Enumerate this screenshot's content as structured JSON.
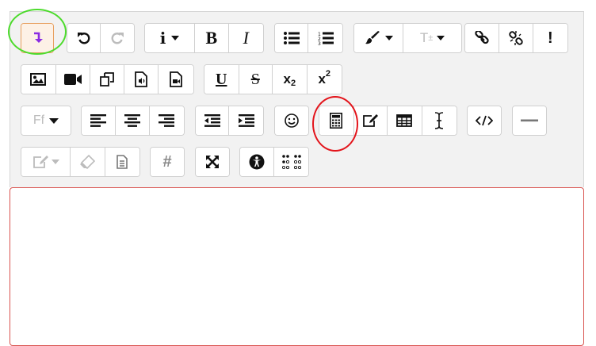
{
  "toolbar": {
    "bold_label": "B",
    "italic_label": "I",
    "underline_label": "U",
    "strike_label": "S",
    "subscript_label": "x",
    "subscript_mark": "2",
    "superscript_label": "x",
    "superscript_mark": "2",
    "font_family_label": "Ff",
    "font_size_label": "T",
    "font_size_mark": "±",
    "hash_label": "#",
    "info_label": "i",
    "alert_label": "!"
  },
  "highlights": {
    "collapse_ring_color": "#4cdb2c",
    "equation_ring_color": "#e3141b"
  },
  "colors": {
    "accent_purple": "#8a2be2",
    "collapse_border": "#e8a060",
    "editor_border": "#d9534f"
  },
  "editor": {
    "content": ""
  }
}
